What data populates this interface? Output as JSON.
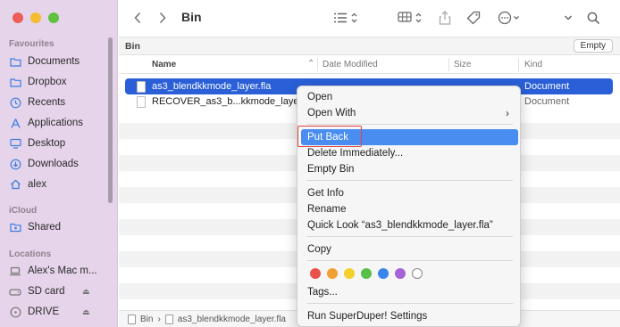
{
  "window": {
    "title": "Bin"
  },
  "sidebar": {
    "sections": [
      {
        "label": "Favourites"
      },
      {
        "label": "iCloud"
      },
      {
        "label": "Locations"
      }
    ],
    "items": [
      {
        "label": "Documents",
        "icon": "folder-icon"
      },
      {
        "label": "Dropbox",
        "icon": "folder-icon"
      },
      {
        "label": "Recents",
        "icon": "clock-icon"
      },
      {
        "label": "Applications",
        "icon": "applications-icon"
      },
      {
        "label": "Desktop",
        "icon": "desktop-icon"
      },
      {
        "label": "Downloads",
        "icon": "download-icon"
      },
      {
        "label": "alex",
        "icon": "home-icon"
      },
      {
        "label": "Shared",
        "icon": "shared-icon"
      },
      {
        "label": "Alex's Mac m...",
        "icon": "laptop-icon"
      },
      {
        "label": "SD card",
        "icon": "drive-icon"
      },
      {
        "label": "DRIVE",
        "icon": "drive-icon"
      }
    ]
  },
  "pathbar": {
    "location": "Bin",
    "empty_label": "Empty"
  },
  "columns": {
    "name": "Name",
    "date": "Date Modified",
    "size": "Size",
    "kind": "Kind"
  },
  "files": [
    {
      "name": "as3_blendkkmode_layer.fla",
      "kind": "Document"
    },
    {
      "name": "RECOVER_as3_b...kkmode_layer",
      "kind": "Document"
    }
  ],
  "status": {
    "root": "Bin",
    "file": "as3_blendkkmode_layer.fla"
  },
  "context_menu": {
    "open": "Open",
    "open_with": "Open With",
    "put_back": "Put Back",
    "delete_immediately": "Delete Immediately...",
    "empty_bin": "Empty Bin",
    "get_info": "Get Info",
    "rename": "Rename",
    "quick_look": "Quick Look “as3_blendkkmode_layer.fla”",
    "copy": "Copy",
    "tags": "Tags...",
    "run_superduper": "Run SuperDuper! Settings",
    "tag_colors": [
      "#e8524a",
      "#f0a030",
      "#f5cf2a",
      "#57c049",
      "#3a84ee",
      "#a663d6"
    ]
  }
}
